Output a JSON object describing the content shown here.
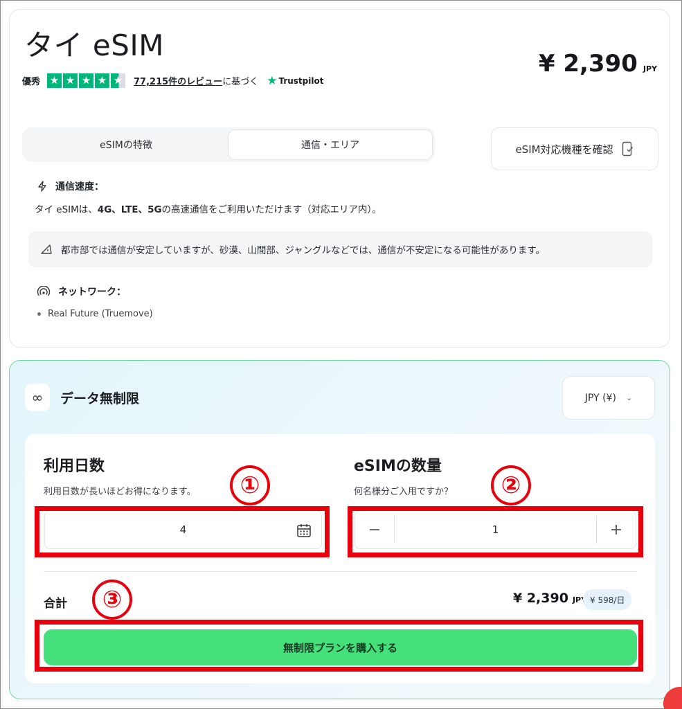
{
  "product": {
    "title": "タイ eSIM",
    "price": "¥ 2,390",
    "currency": "JPY",
    "rating_label": "優秀",
    "stars": 4.5,
    "reviews_link": "77,215件のレビュー",
    "reviews_suffix": "に基づく",
    "trustpilot": "Trustpilot"
  },
  "tabs": [
    {
      "label": "eSIMの特徴",
      "active": false
    },
    {
      "label": "通信・エリア",
      "active": true
    }
  ],
  "compat_button": "eSIM対応機種を確認",
  "speed": {
    "heading": "通信速度：",
    "text_prefix": "タイ eSIMは、",
    "text_bold": "4G、LTE、5G",
    "text_suffix": "の高速通信をご利用いただけます（対応エリア内）。"
  },
  "notice": "都市部では通信が安定していますが、砂漠、山間部、ジャングルなどでは、通信が不安定になる可能性があります。",
  "network": {
    "heading": "ネットワーク：",
    "items": [
      "Real Future (Truemove)"
    ]
  },
  "plan": {
    "icon": "∞",
    "name": "データ無制限",
    "currency_select": "JPY (¥)",
    "days_label": "利用日数",
    "days_sub": "利用日数が長いほどお得になります。",
    "days_value": "4",
    "qty_label": "eSIMの数量",
    "qty_sub": "何名様分ご入用ですか？",
    "qty_value": "1",
    "qty_minus": "−",
    "qty_plus": "+",
    "total_label": "合計",
    "total_amount": "¥ 2,390",
    "total_currency": "JPY",
    "per_day": "¥ 598/日",
    "buy_button": "無制限プランを購入する"
  },
  "annotations": {
    "one": "①",
    "two": "②",
    "three": "③"
  },
  "colors": {
    "accent_green": "#45e07c",
    "trustpilot_green": "#00b67a",
    "annotation_red": "#e8000d"
  }
}
